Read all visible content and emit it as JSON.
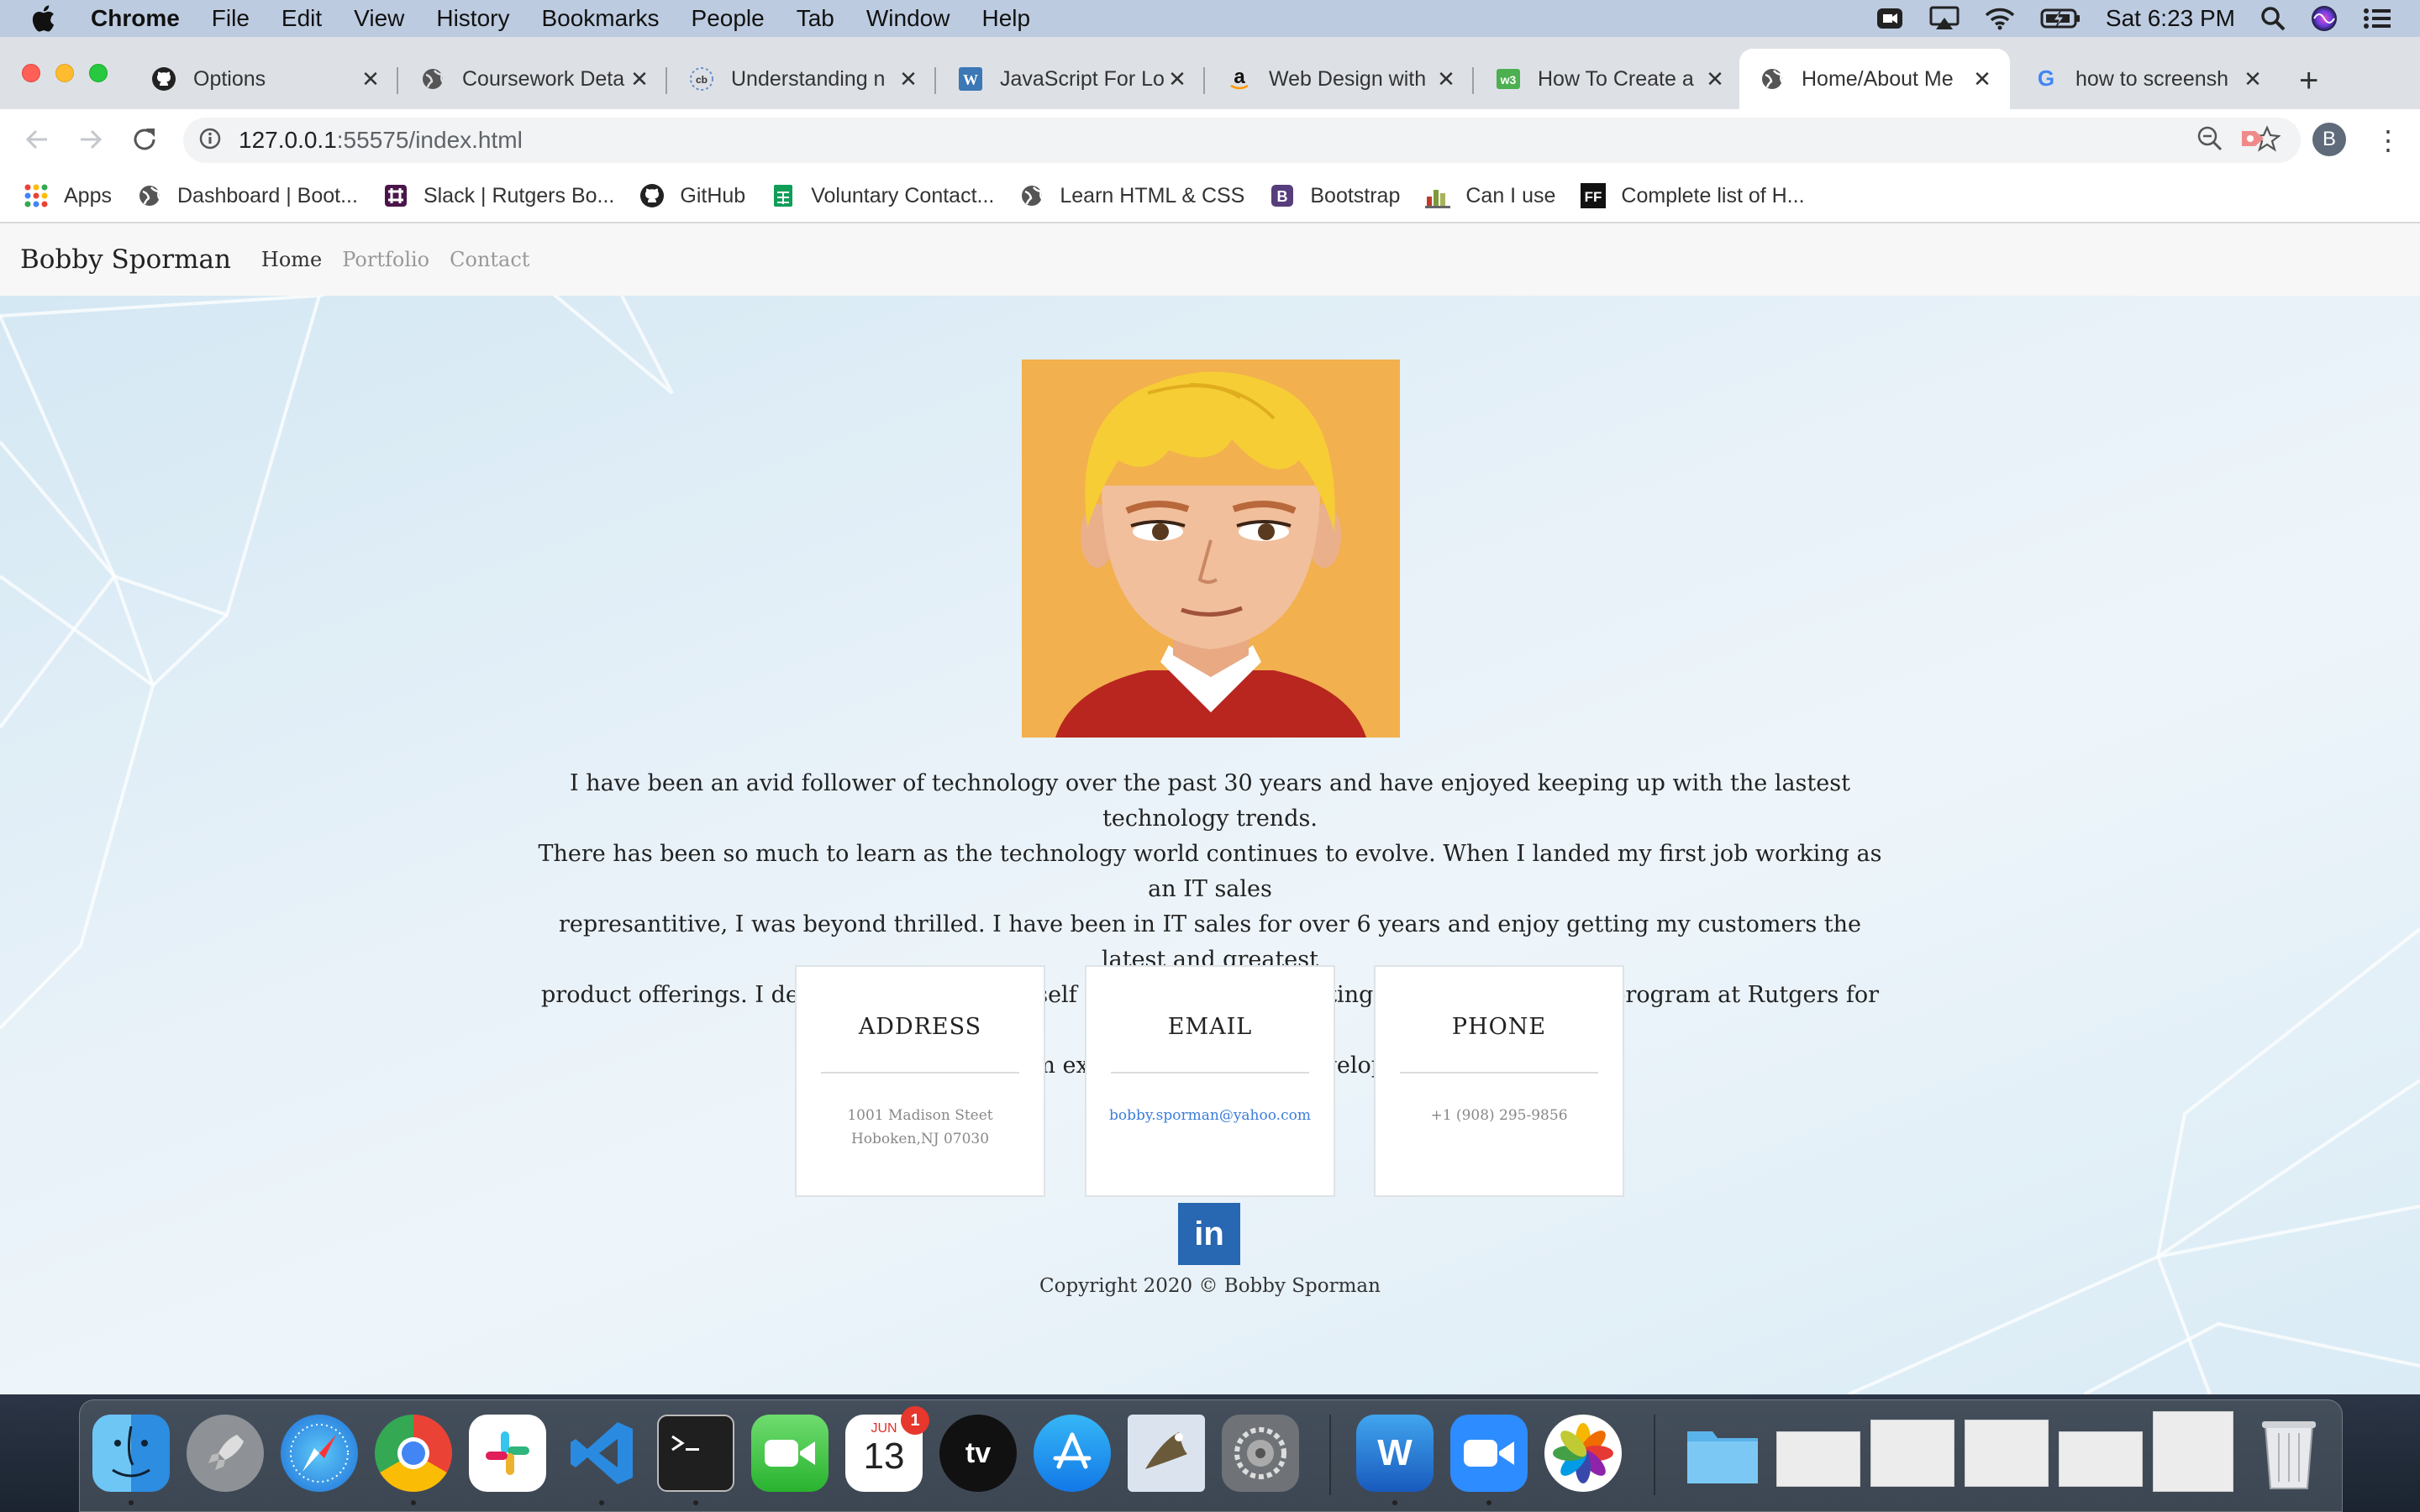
{
  "menubar": {
    "app_name": "Chrome",
    "menus": [
      "File",
      "Edit",
      "View",
      "History",
      "Bookmarks",
      "People",
      "Tab",
      "Window",
      "Help"
    ],
    "clock": "Sat 6:23 PM"
  },
  "tabs": [
    {
      "title": "Options",
      "icon": "github-icon"
    },
    {
      "title": "Coursework Deta",
      "icon": "globe-icon"
    },
    {
      "title": "Understanding n",
      "icon": "cb-icon"
    },
    {
      "title": "JavaScript For Lo",
      "icon": "wordpress-icon"
    },
    {
      "title": "Web Design with",
      "icon": "amazon-icon"
    },
    {
      "title": "How To Create a",
      "icon": "w3-icon"
    },
    {
      "title": "Home/About Me",
      "icon": "globe-icon"
    },
    {
      "title": "how to screensh",
      "icon": "google-icon"
    }
  ],
  "omnibox": {
    "host": "127.0.0.1",
    "path": ":55575/index.html"
  },
  "profile_initial": "B",
  "bookmarks": [
    {
      "label": "Apps",
      "icon": "apps-grid-icon"
    },
    {
      "label": "Dashboard | Boot...",
      "icon": "globe-icon"
    },
    {
      "label": "Slack | Rutgers Bo...",
      "icon": "slack-icon"
    },
    {
      "label": "GitHub",
      "icon": "github-icon"
    },
    {
      "label": "Voluntary Contact...",
      "icon": "sheets-icon"
    },
    {
      "label": "Learn HTML & CSS",
      "icon": "globe-icon"
    },
    {
      "label": "Bootstrap",
      "icon": "bootstrap-icon"
    },
    {
      "label": "Can I use",
      "icon": "caniuse-icon"
    },
    {
      "label": "Complete list of H...",
      "icon": "ff-icon"
    }
  ],
  "site": {
    "brand": "Bobby Sporman",
    "nav": [
      "Home",
      "Portfolio",
      "Contact"
    ],
    "bio_lines": [
      "I have been an avid follower of technology over the past 30 years and have enjoyed keeping up with the lastest technology trends.",
      "There has been so much to learn as the technology world continues to evolve. When I landed my first job working as an IT sales",
      "represantitive, I was beyond thrilled. I have been in IT sales for over 6 years and enjoy getting my customers the latest and greatest",
      "product offerings. I decided to reinvent myself though. After completing a further education program at Rutgers for Full Stack",
      "Development, I am excited to enter the development workspace."
    ],
    "cards": {
      "address": {
        "title": "ADDRESS",
        "line1": "1001 Madison Steet",
        "line2": "Hoboken,NJ 07030"
      },
      "email": {
        "title": "EMAIL",
        "value": "bobby.sporman@yahoo.com"
      },
      "phone": {
        "title": "PHONE",
        "value": "+1 (908) 295-9856"
      }
    },
    "linkedin_label": "in",
    "copyright": "Copyright 2020 © Bobby Sporman"
  },
  "dock": {
    "calendar_month": "JUN",
    "calendar_day": "13",
    "calendar_badge": "1",
    "tv_label": "tv",
    "word_label": "W",
    "apps": [
      "finder-icon",
      "launchpad-icon",
      "safari-icon",
      "chrome-icon",
      "slack-icon",
      "vscode-icon",
      "terminal-icon",
      "facetime-icon",
      "calendar-icon",
      "apple-tv-icon",
      "app-store-icon",
      "mail-icon",
      "system-preferences-icon",
      "word-icon",
      "zoom-icon",
      "photos-icon",
      "folder-icon",
      "trash-icon"
    ]
  }
}
